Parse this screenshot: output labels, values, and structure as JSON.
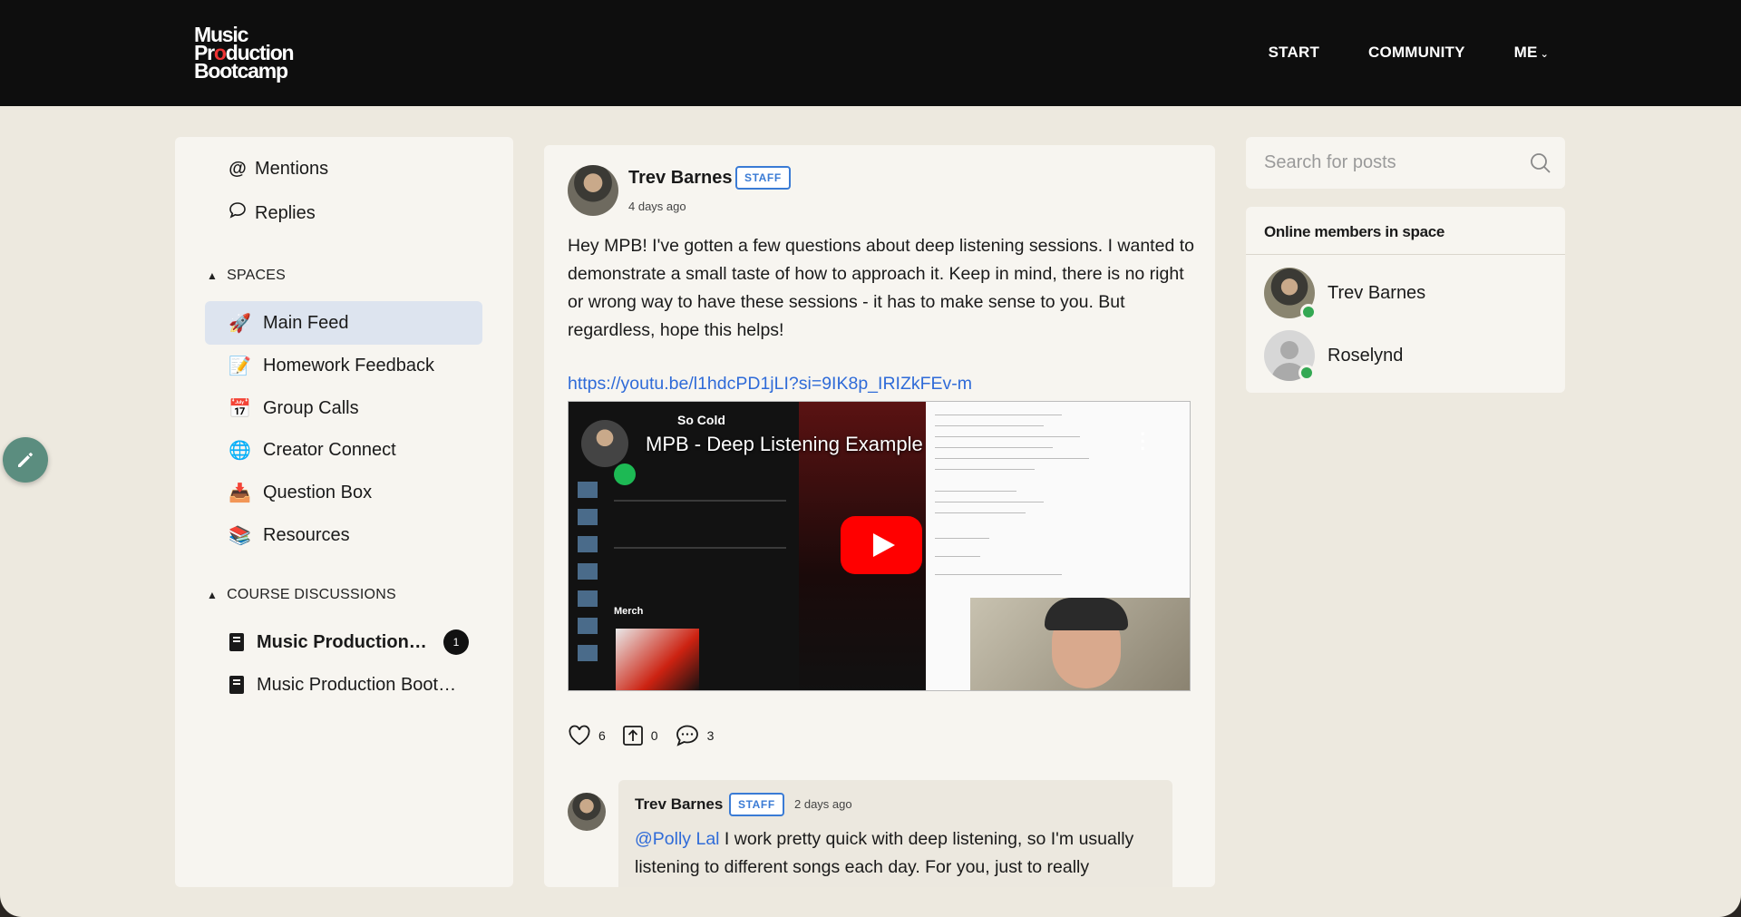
{
  "header": {
    "logo_line1": "Music",
    "logo_line2a": "Pr",
    "logo_line2b": "duction",
    "logo_line3": "Bootcamp",
    "nav": {
      "start": "START",
      "community": "COMMUNITY",
      "me": "ME"
    }
  },
  "sidebar": {
    "mentions": "Mentions",
    "replies": "Replies",
    "spaces_heading": "SPACES",
    "spaces": [
      {
        "label": "Main Feed",
        "emoji": "🚀"
      },
      {
        "label": "Homework Feedback",
        "emoji": "📝"
      },
      {
        "label": "Group Calls",
        "emoji": "📅"
      },
      {
        "label": "Creator Connect",
        "emoji": "🌐"
      },
      {
        "label": "Question Box",
        "emoji": "📥"
      },
      {
        "label": "Resources",
        "emoji": "📚"
      }
    ],
    "courses_heading": "COURSE DISCUSSIONS",
    "courses": [
      {
        "label": "Music Production B...",
        "badge": "1"
      },
      {
        "label": "Music Production Bootc..."
      }
    ]
  },
  "post": {
    "author": "Trev Barnes",
    "role": "STAFF",
    "time": "4 days ago",
    "body": "Hey MPB! I've gotten a few questions about deep listening sessions. I wanted to demonstrate a small taste of how to approach it. Keep in mind, there is no right or wrong way to have these sessions - it has to make sense to you. But regardless, hope this helps!",
    "link": "https://youtu.be/l1hdcPD1jLI?si=9IK8p_IRIZkFEv-m",
    "video": {
      "title": "MPB - Deep Listening Example",
      "song": "So Cold",
      "merch": "Merch"
    },
    "likes": "6",
    "shares": "0",
    "comments": "3"
  },
  "comment": {
    "author": "Trev Barnes",
    "role": "STAFF",
    "time": "2 days ago",
    "mention": "@Polly Lal",
    "text": " I work pretty quick with deep listening, so I'm usually listening to different songs each day. For you, just to really"
  },
  "search": {
    "placeholder": "Search for posts"
  },
  "online": {
    "heading": "Online members in space",
    "members": [
      {
        "name": "Trev Barnes"
      },
      {
        "name": "Roselynd"
      }
    ]
  },
  "colors": {
    "accent_blue": "#2f6bd8",
    "header_bg": "#0e0e0e",
    "online_green": "#34a853",
    "active_space_bg": "#dde4ef"
  }
}
